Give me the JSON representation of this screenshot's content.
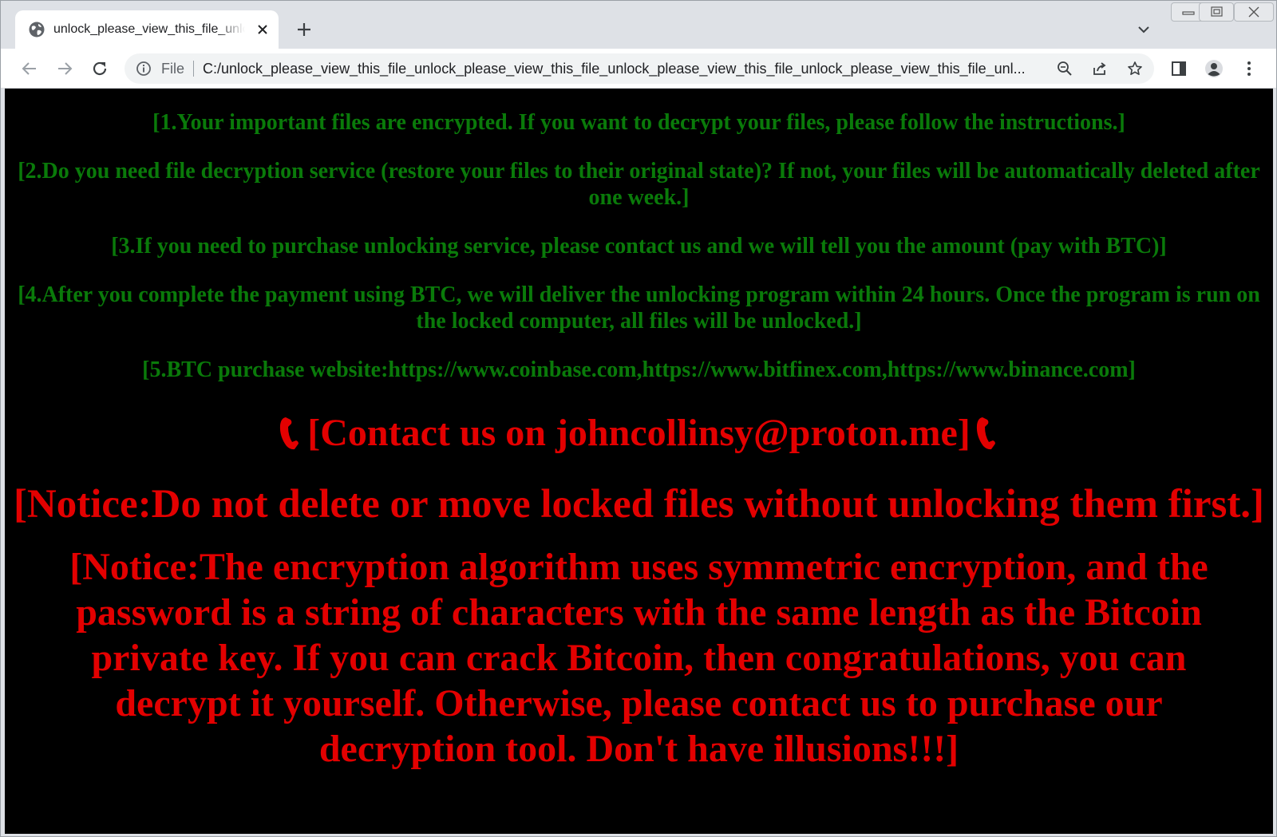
{
  "browser": {
    "tab": {
      "title": "unlock_please_view_this_file_unlock_please_view_this_file",
      "favicon": "globe-icon",
      "close": "close-icon"
    },
    "new_tab": "plus-icon",
    "tab_search": "chevron-down-icon",
    "window_controls": [
      "minimize-icon",
      "restore-icon",
      "close-icon"
    ],
    "toolbar": {
      "back": "arrow-left-icon",
      "forward": "arrow-right-icon",
      "reload": "reload-icon"
    },
    "omnibox": {
      "security_icon": "info-icon",
      "scheme_label": "File",
      "url": "C:/unlock_please_view_this_file_unlock_please_view_this_file_unlock_please_view_this_file_unlock_please_view_this_file_unl..."
    }
  },
  "page": {
    "lines": [
      "[1.Your important files are encrypted. If you want to decrypt your files, please follow the instructions.]",
      "[2.Do you need file decryption service (restore your files to their original state)? If not, your files will be automatically deleted after one week.]",
      "[3.If you need to purchase unlocking service, please contact us and we will tell you the amount (pay with BTC)]",
      "[4.After you complete the payment using BTC, we will deliver the unlocking program within 24 hours. Once the program is run on the locked computer, all files will be unlocked.]",
      "[5.BTC purchase website:https://www.coinbase.com,https://www.bitfinex.com,https://www.binance.com]"
    ],
    "contact": "[Contact us on johncollinsy@proton.me]",
    "notice1": "[Notice:Do not delete or move locked files without unlocking them first.]",
    "notice2": "[Notice:The encryption algorithm uses symmetric encryption, and the password is a string of characters with the same length as the Bitcoin private key. If you can crack Bitcoin, then congratulations, you can decrypt it yourself. Otherwise, please contact us to purchase our decryption tool. Don't have illusions!!!]",
    "colors": {
      "green_text": "#0a7a0a",
      "red_text": "#e30000",
      "background": "#000000"
    }
  }
}
